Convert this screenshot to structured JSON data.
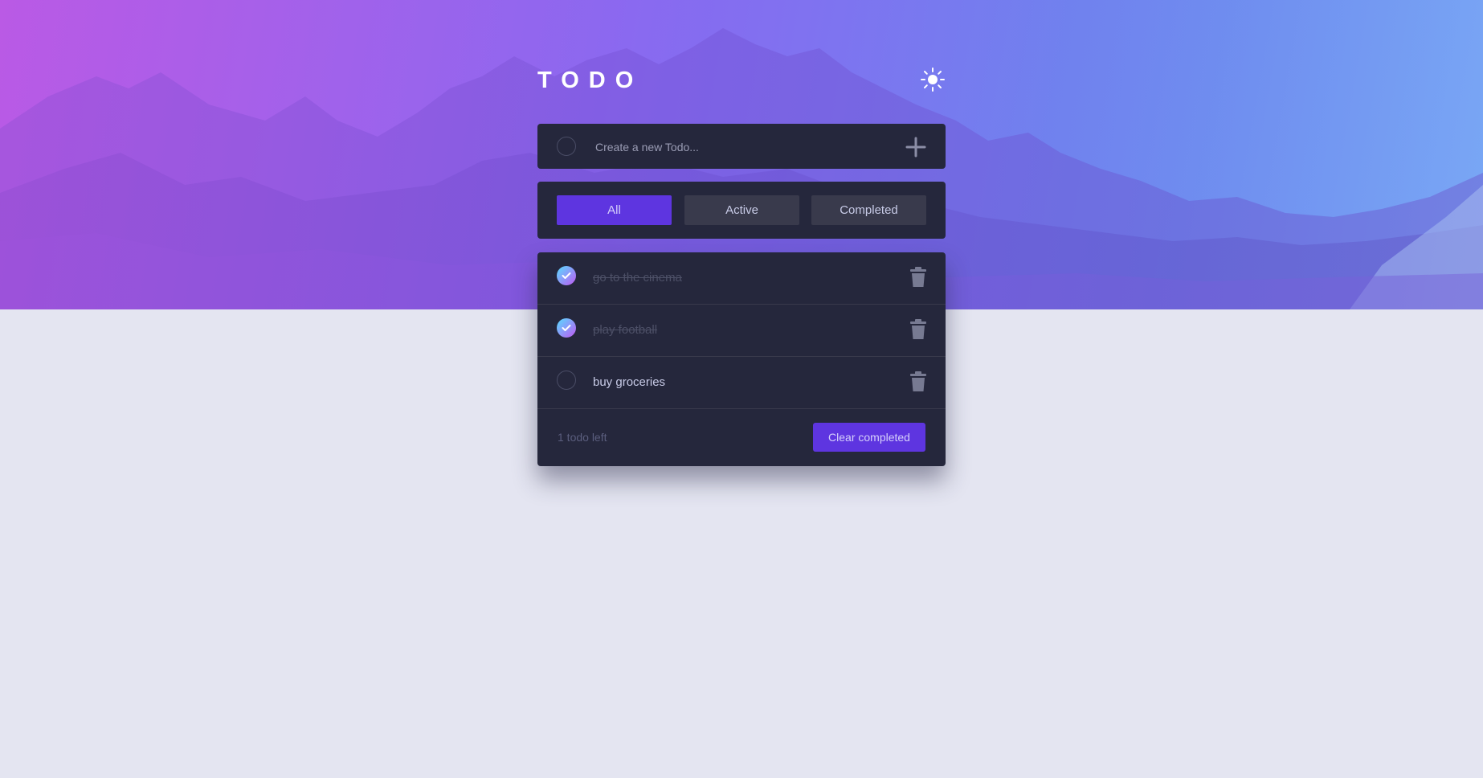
{
  "app": {
    "title": "TODO",
    "theme_toggle_icon": "sun-icon"
  },
  "new_todo": {
    "placeholder": "Create a new Todo...",
    "value": "",
    "add_icon": "plus-icon"
  },
  "filters": {
    "items": [
      {
        "label": "All",
        "active": true
      },
      {
        "label": "Active",
        "active": false
      },
      {
        "label": "Completed",
        "active": false
      }
    ]
  },
  "todos": [
    {
      "text": "go to the cinema",
      "completed": true
    },
    {
      "text": "play football",
      "completed": true
    },
    {
      "text": "buy groceries",
      "completed": false
    }
  ],
  "footer": {
    "items_left": "1 todo left",
    "clear_label": "Clear completed"
  },
  "colors": {
    "accent": "#5e35e0",
    "card": "#25273c",
    "page_background": "#e4e5f1",
    "check_gradient_start": "#57ddff",
    "check_gradient_end": "#c058f3"
  }
}
